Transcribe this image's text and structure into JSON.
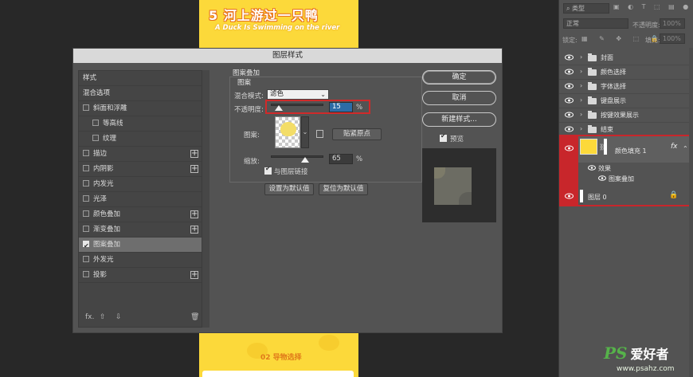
{
  "artwork": {
    "title": "5 河上游过一只鸭",
    "subtitle": "A Duck Is Swimming on the river",
    "footer": "02 导物选择"
  },
  "dialog": {
    "title": "图层样式",
    "styles_list": [
      {
        "label": "样式",
        "header": true
      },
      {
        "label": "混合选项",
        "header": true
      },
      {
        "label": "斜面和浮雕",
        "checked": false,
        "plus": false
      },
      {
        "label": "等高线",
        "checked": false,
        "indent": true
      },
      {
        "label": "纹理",
        "checked": false,
        "indent": true
      },
      {
        "label": "描边",
        "checked": false,
        "plus": true
      },
      {
        "label": "内阴影",
        "checked": false,
        "plus": true
      },
      {
        "label": "内发光",
        "checked": false,
        "plus": false
      },
      {
        "label": "光泽",
        "checked": false,
        "plus": false
      },
      {
        "label": "颜色叠加",
        "checked": false,
        "plus": true
      },
      {
        "label": "渐变叠加",
        "checked": false,
        "plus": true
      },
      {
        "label": "图案叠加",
        "checked": true,
        "plus": false,
        "selected": true
      },
      {
        "label": "外发光",
        "checked": false,
        "plus": false
      },
      {
        "label": "投影",
        "checked": false,
        "plus": true
      }
    ],
    "toolbar": {
      "fx": "fx.",
      "up": "⇧",
      "down": "⇩",
      "trash": "🗑"
    },
    "pattern_overlay": {
      "group_title": "图案叠加",
      "sub_title": "图案",
      "blend_mode_label": "混合模式:",
      "blend_mode_value": "滤色",
      "opacity_label": "不透明度:",
      "opacity_value": "15",
      "opacity_unit": "%",
      "pattern_label": "图案:",
      "snap_origin": "贴紧原点",
      "scale_label": "缩放:",
      "scale_value": "65",
      "scale_unit": "%",
      "link_label": "与图层链接",
      "set_default": "设置为默认值",
      "reset_default": "复位为默认值"
    },
    "buttons": {
      "ok": "确定",
      "cancel": "取消",
      "new_style": "新建样式...",
      "preview": "预览"
    }
  },
  "layers_panel": {
    "filter_type": "类型",
    "blend_mode": "正常",
    "opacity_label": "不透明度:",
    "opacity_value": "100%",
    "lock_label": "锁定:",
    "fill_label": "填充:",
    "fill_value": "100%",
    "groups": [
      "封面",
      "颜色选择",
      "字体选择",
      "键盘展示",
      "按键效果展示",
      "结束"
    ],
    "selected_layer": "颜色填充 1",
    "fx": "fx",
    "effects_label": "效果",
    "effect_item": "图案叠加",
    "bottom_layer": "图层 0"
  },
  "watermark": {
    "brand": "PS",
    "cn": "爱好者",
    "url": "www.psahz.com"
  }
}
